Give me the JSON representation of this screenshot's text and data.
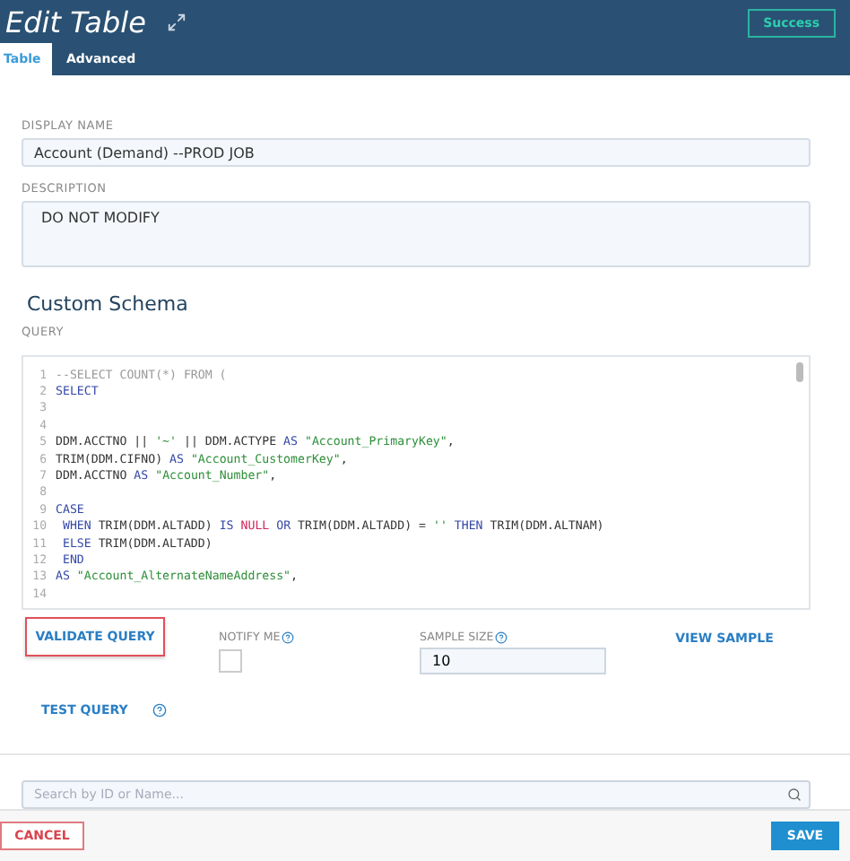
{
  "window": {
    "title": "Edit Table",
    "status_badge": "Success"
  },
  "tabs": [
    {
      "label": "Table",
      "selected": true
    },
    {
      "label": "Advanced",
      "selected": false
    }
  ],
  "display_name": {
    "label": "DISPLAY NAME",
    "value": "Account (Demand) --PROD JOB"
  },
  "description": {
    "label": "DESCRIPTION",
    "value": "DO NOT MODIFY"
  },
  "section_title": "Custom Schema",
  "query": {
    "label": "QUERY",
    "lines": [
      {
        "number": "1",
        "tokens": [
          {
            "kind": "comment",
            "text": "--SELECT COUNT(*) FROM ("
          }
        ]
      },
      {
        "number": "2",
        "tokens": [
          {
            "kind": "keyword",
            "text": "SELECT"
          }
        ]
      },
      {
        "number": "3"
      },
      {
        "number": "4"
      },
      {
        "number": "5",
        "tokens": [
          {
            "kind": "plain",
            "text": "DDM.ACCTNO || "
          },
          {
            "kind": "string",
            "text": "'~'"
          },
          {
            "kind": "plain",
            "text": " || DDM.ACTYPE "
          },
          {
            "kind": "keyword",
            "text": "AS"
          },
          {
            "kind": "string",
            "text": " \"Account_PrimaryKey\""
          },
          {
            "kind": "plain",
            "text": ","
          }
        ]
      },
      {
        "number": "6",
        "tokens": [
          {
            "kind": "plain",
            "text": "TRIM(DDM.CIFNO) "
          },
          {
            "kind": "keyword",
            "text": "AS"
          },
          {
            "kind": "string",
            "text": " \"Account_CustomerKey\""
          },
          {
            "kind": "plain",
            "text": ","
          }
        ]
      },
      {
        "number": "7",
        "tokens": [
          {
            "kind": "plain",
            "text": "DDM.ACCTNO "
          },
          {
            "kind": "keyword",
            "text": "AS"
          },
          {
            "kind": "string",
            "text": " \"Account_Number\""
          },
          {
            "kind": "plain",
            "text": ","
          }
        ]
      },
      {
        "number": "8"
      },
      {
        "number": "9",
        "tokens": [
          {
            "kind": "keyword",
            "text": "CASE"
          }
        ]
      },
      {
        "number": "10",
        "tokens": [
          {
            "kind": "keyword",
            "text": " WHEN"
          },
          {
            "kind": "plain",
            "text": " TRIM(DDM.ALTADD) "
          },
          {
            "kind": "keyword",
            "text": "IS"
          },
          {
            "kind": "null",
            "text": " NULL"
          },
          {
            "kind": "keyword",
            "text": " OR"
          },
          {
            "kind": "plain",
            "text": " TRIM(DDM.ALTADD) = "
          },
          {
            "kind": "string",
            "text": "''"
          },
          {
            "kind": "keyword",
            "text": " THEN"
          },
          {
            "kind": "plain",
            "text": " TRIM(DDM.ALTNAM)"
          }
        ]
      },
      {
        "number": "11",
        "tokens": [
          {
            "kind": "keyword",
            "text": " ELSE"
          },
          {
            "kind": "plain",
            "text": " TRIM(DDM.ALTADD)"
          }
        ]
      },
      {
        "number": "12",
        "tokens": [
          {
            "kind": "keyword",
            "text": " END"
          }
        ]
      },
      {
        "number": "13",
        "tokens": [
          {
            "kind": "keyword",
            "text": "AS"
          },
          {
            "kind": "string",
            "text": " \"Account_AlternateNameAddress\""
          },
          {
            "kind": "plain",
            "text": ","
          }
        ]
      },
      {
        "number": "14"
      }
    ]
  },
  "validate_button": "VALIDATE QUERY",
  "notify": {
    "label": "NOTIFY ME",
    "checked": false
  },
  "sample_size": {
    "label": "SAMPLE SIZE",
    "value": "10"
  },
  "view_sample": "VIEW SAMPLE",
  "test_query": "TEST QUERY",
  "search": {
    "placeholder": "Search by ID or Name..."
  },
  "footer": {
    "cancel": "CANCEL",
    "save": "SAVE"
  }
}
